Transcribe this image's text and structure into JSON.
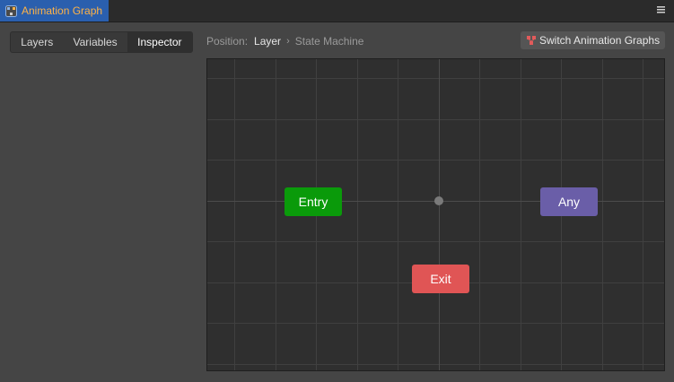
{
  "window": {
    "title": "Animation Graph",
    "tab_icon": "animation-graph-icon",
    "menu_icon": "hamburger-menu-icon"
  },
  "left_panel": {
    "tabs": [
      {
        "label": "Layers",
        "selected": false
      },
      {
        "label": "Variables",
        "selected": false
      },
      {
        "label": "Inspector",
        "selected": true
      }
    ]
  },
  "breadcrumb": {
    "label": "Position:",
    "layer": "Layer",
    "separator": "›",
    "current": "State Machine"
  },
  "toolbar": {
    "switch_label": "Switch Animation Graphs",
    "switch_icon": "switch-graph-icon"
  },
  "graph": {
    "nodes": {
      "entry": {
        "label": "Entry",
        "color": "#0a9a0a"
      },
      "any": {
        "label": "Any",
        "color": "#6a5ea8"
      },
      "exit": {
        "label": "Exit",
        "color": "#e05555"
      }
    }
  },
  "colors": {
    "accent_tab": "#2a5fae",
    "tab_title": "#ffb347"
  }
}
